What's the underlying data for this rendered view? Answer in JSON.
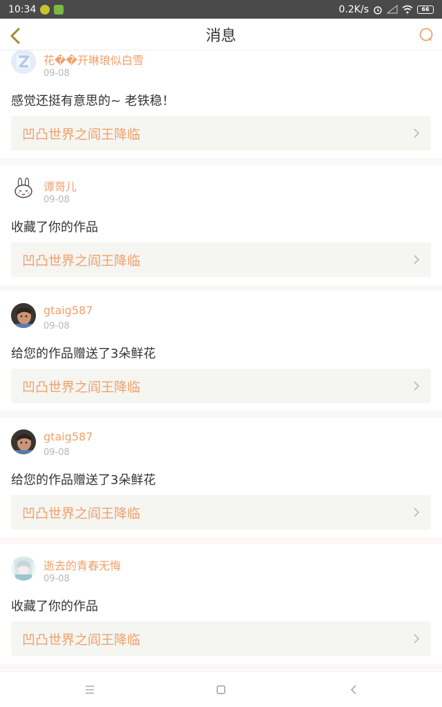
{
  "status_bar": {
    "time": "10:34",
    "net_speed": "0.2K/s",
    "battery": "66"
  },
  "header": {
    "title": "消息"
  },
  "colors": {
    "accent": "#f0a06a",
    "link_bg": "#f5f5f1",
    "divider": "#fbf7f7"
  },
  "messages": [
    {
      "user": "花��开琳琅似白雪",
      "date": "09-08",
      "text": "感觉还挺有意思的~ 老铁稳！",
      "work_title": "凹凸世界之阎王降临",
      "avatar": "default-avatar-icon"
    },
    {
      "user": "谭哥儿",
      "date": "09-08",
      "text": "收藏了你的作品",
      "work_title": "凹凸世界之阎王降临",
      "avatar": "bunny-avatar"
    },
    {
      "user": "gtaig587",
      "date": "09-08",
      "text": "给您的作品赠送了3朵鲜花",
      "work_title": "凹凸世界之阎王降临",
      "avatar": "photo-avatar"
    },
    {
      "user": "gtaig587",
      "date": "09-08",
      "text": "给您的作品赠送了3朵鲜花",
      "work_title": "凹凸世界之阎王降临",
      "avatar": "photo-avatar"
    },
    {
      "user": "逝去的青春无悔",
      "date": "09-08",
      "text": "收藏了你的作品",
      "work_title": "凹凸世界之阎王降临",
      "avatar": "anime-avatar"
    }
  ]
}
